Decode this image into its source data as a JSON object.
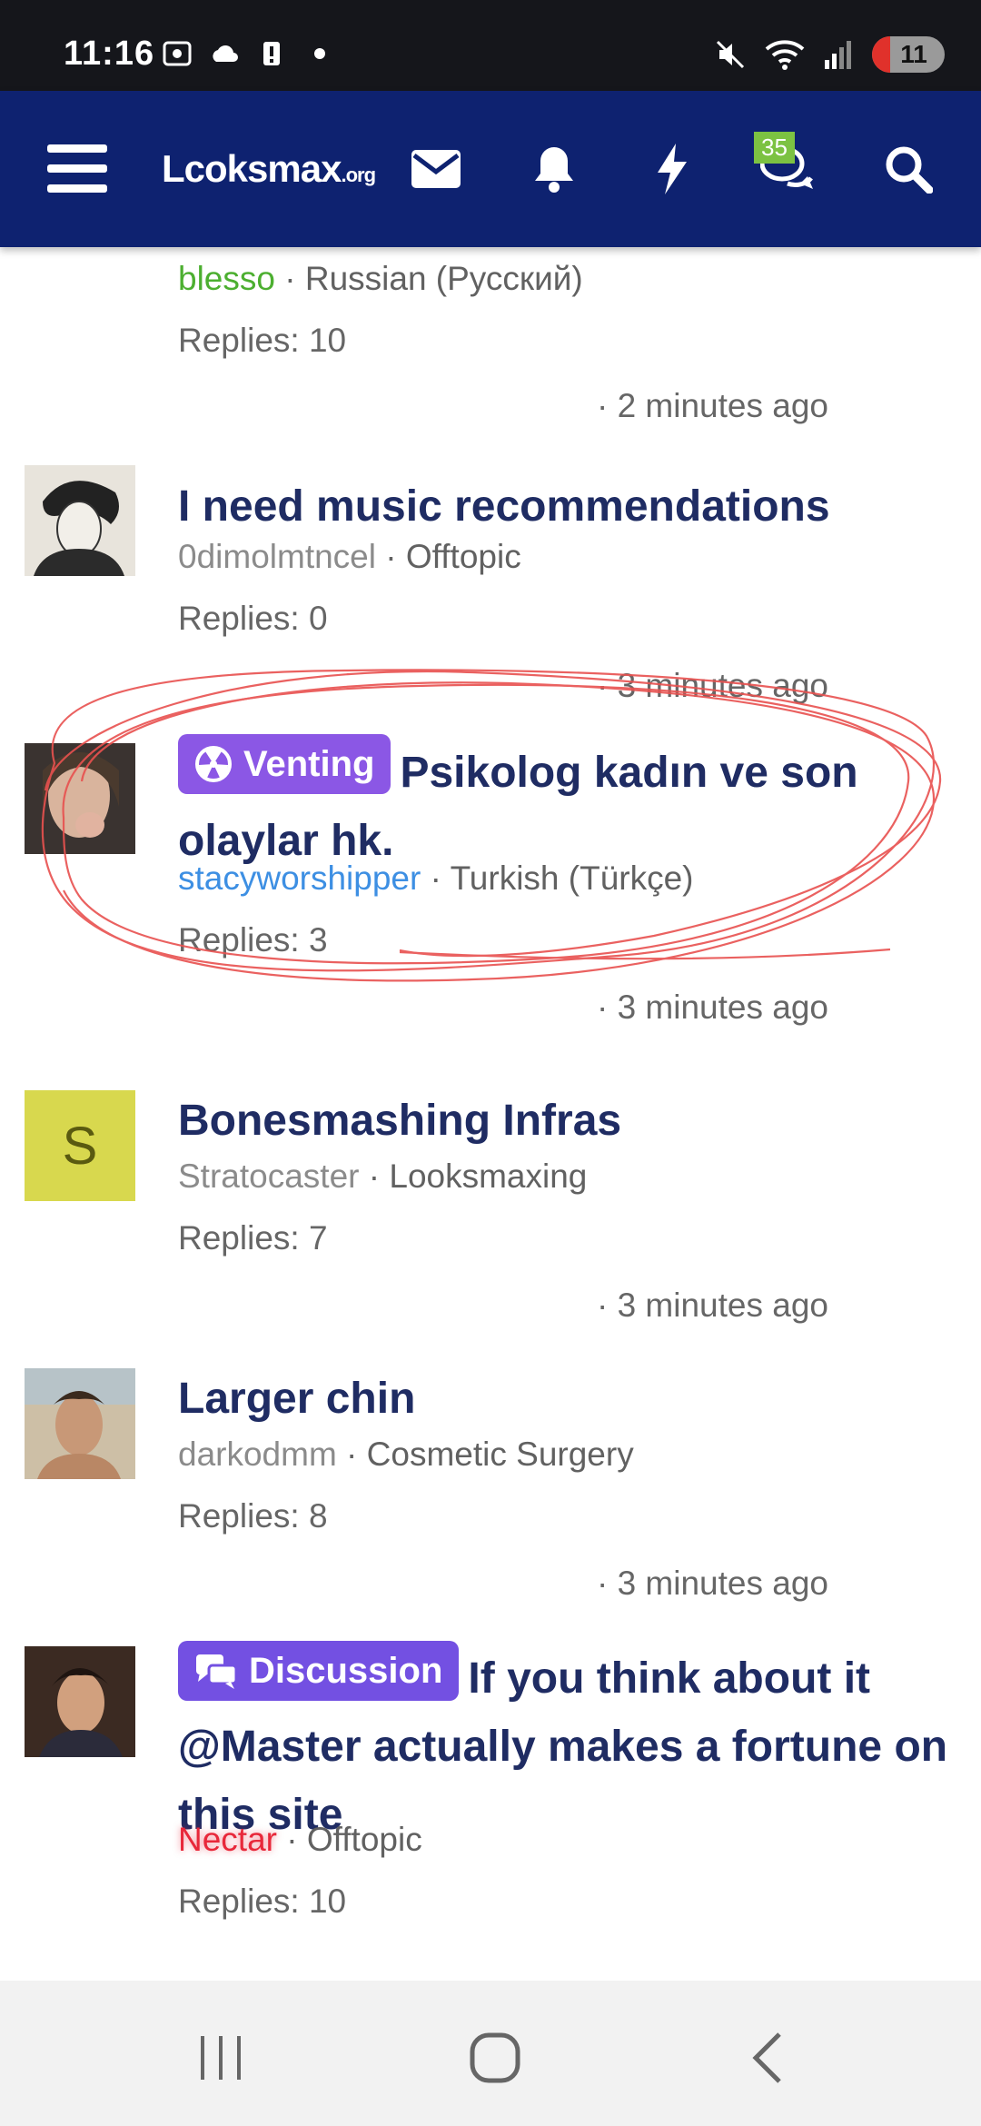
{
  "status_bar": {
    "time": "11:16",
    "battery": "11",
    "icons": [
      "screenshot-icon",
      "cloud-icon",
      "alert-icon",
      "dot-icon",
      "mute-icon",
      "wifi-icon",
      "signal-icon",
      "battery-icon"
    ]
  },
  "header": {
    "logo_main": "Lcoksmax",
    "logo_suffix": ".org",
    "conversations_badge": "35",
    "icons": [
      "menu-icon",
      "mail-icon",
      "bell-icon",
      "bolt-icon",
      "chat-icon",
      "search-icon"
    ],
    "brand_color": "#0e2270"
  },
  "threads": [
    {
      "title": "",
      "prefix": "",
      "user": "blesso",
      "forum": "Russian (Русский)",
      "replies": "Replies: 10",
      "time": "· 2 minutes ago"
    },
    {
      "title": "I need music recommendations",
      "prefix": "",
      "user": "0dimolmtncel",
      "forum": "Offtopic",
      "replies": "Replies: 0",
      "time": "· 3 minutes ago"
    },
    {
      "title": "Psikolog kadın ve son olaylar hk.",
      "prefix": "Venting",
      "user": "stacyworshipper",
      "forum": "Turkish (Türkçe)",
      "replies": "Replies: 3",
      "time": "· 3 minutes ago"
    },
    {
      "title": "Bonesmashing Infras",
      "prefix": "",
      "avatar_letter": "S",
      "user": "Stratocaster",
      "forum": "Looksmaxing",
      "replies": "Replies: 7",
      "time": "· 3 minutes ago"
    },
    {
      "title": "Larger chin",
      "prefix": "",
      "user": "darkodmm",
      "forum": "Cosmetic Surgery",
      "replies": "Replies: 8",
      "time": "· 3 minutes ago"
    },
    {
      "title": "If you think about it @Master actually makes a fortune on this site",
      "prefix": "Discussion",
      "user": "Nectar",
      "forum": "Offtopic",
      "replies": "Replies: 10",
      "time": ""
    }
  ],
  "meta_separator": " · ",
  "system_nav": {
    "icons": [
      "recent-apps-icon",
      "home-icon",
      "back-icon"
    ]
  }
}
